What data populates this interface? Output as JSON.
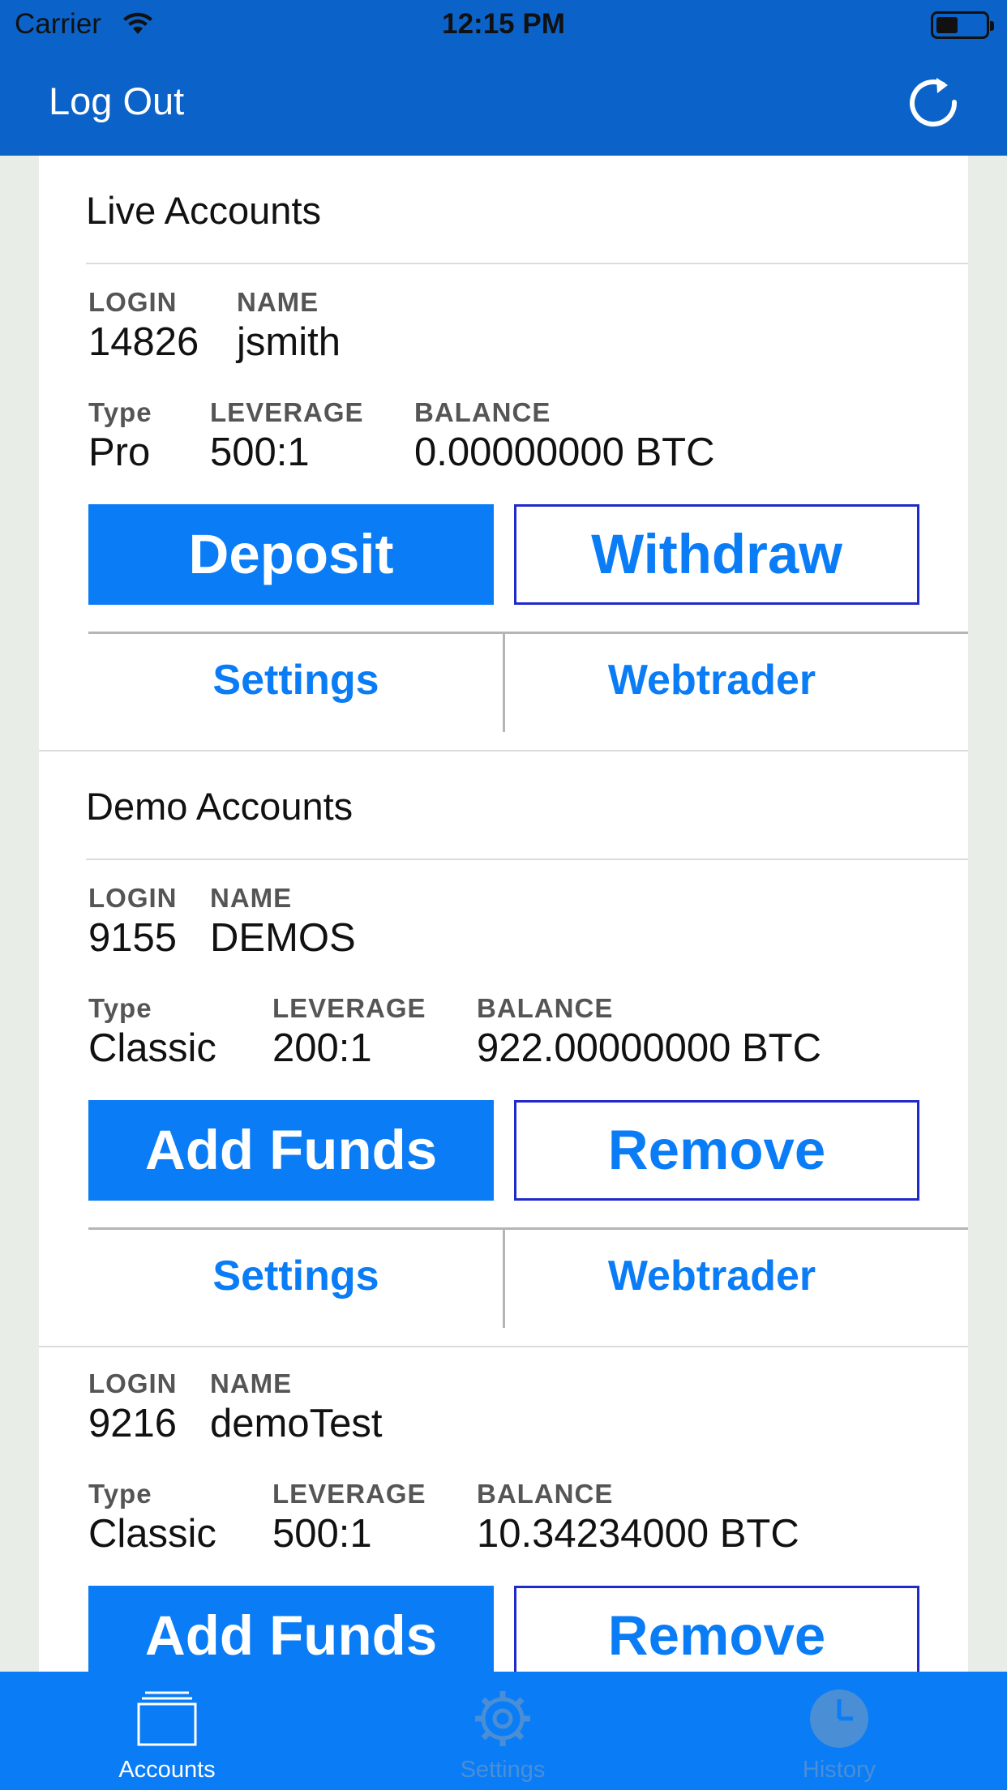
{
  "status": {
    "carrier": "Carrier",
    "time": "12:15 PM"
  },
  "nav": {
    "left": "Log Out",
    "right_icon": "refresh-icon"
  },
  "live": {
    "title": "Live Accounts",
    "accounts": [
      {
        "login_label": "LOGIN",
        "login": "14826",
        "name_label": "NAME",
        "name": "jsmith",
        "type_label": "Type",
        "type": "Pro",
        "leverage_label": "LEVERAGE",
        "leverage": "500:1",
        "balance_label": "BALANCE",
        "balance": "0.00000000 BTC",
        "primary": "Deposit",
        "secondary": "Withdraw",
        "link_left": "Settings",
        "link_right": "Webtrader"
      }
    ]
  },
  "demo": {
    "title": "Demo Accounts",
    "accounts": [
      {
        "login_label": "LOGIN",
        "login": "9155",
        "name_label": "NAME",
        "name": "DEMOS",
        "type_label": "Type",
        "type": "Classic",
        "leverage_label": "LEVERAGE",
        "leverage": "200:1",
        "balance_label": "BALANCE",
        "balance": "922.00000000 BTC",
        "primary": "Add Funds",
        "secondary": "Remove",
        "link_left": "Settings",
        "link_right": "Webtrader"
      },
      {
        "login_label": "LOGIN",
        "login": "9216",
        "name_label": "NAME",
        "name": "demoTest",
        "type_label": "Type",
        "type": "Classic",
        "leverage_label": "LEVERAGE",
        "leverage": "500:1",
        "balance_label": "BALANCE",
        "balance": "10.34234000 BTC",
        "primary": "Add Funds",
        "secondary": "Remove"
      }
    ]
  },
  "tabs": [
    {
      "label": "Accounts",
      "icon": "accounts-icon",
      "active": true
    },
    {
      "label": "Settings",
      "icon": "gear-icon",
      "active": false
    },
    {
      "label": "History",
      "icon": "clock-icon",
      "active": false
    }
  ],
  "colors": {
    "nav": "#0b63c9",
    "accent": "#0a7cf5",
    "outline": "#2029c9",
    "tab_inactive": "#4a8fd6",
    "tab_active": "#ffffff"
  }
}
